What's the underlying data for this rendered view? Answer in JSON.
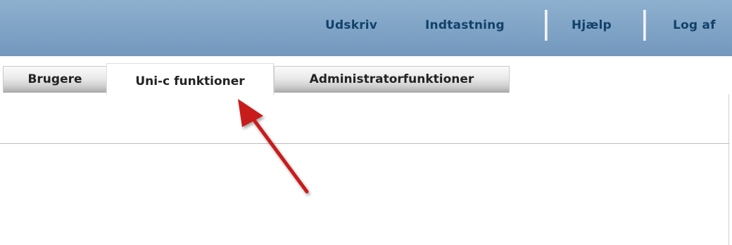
{
  "header": {
    "nav": [
      {
        "label": "Udskriv"
      },
      {
        "label": "Indtastning"
      },
      {
        "label": "Hjælp"
      },
      {
        "label": "Log af"
      }
    ]
  },
  "tabs": [
    {
      "label": "Brugere",
      "active": false
    },
    {
      "label": "Uni-c funktioner",
      "active": true
    },
    {
      "label": "Administratorfunktioner",
      "active": false
    }
  ],
  "colors": {
    "header_bg": "#7fa3c5",
    "nav_text": "#11416a",
    "annotation_arrow": "#c81c1c"
  }
}
